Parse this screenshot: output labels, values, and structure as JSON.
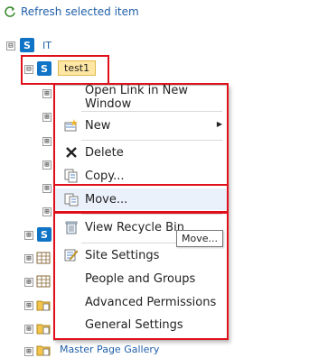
{
  "toolbar": {
    "refresh_label": "Refresh selected item"
  },
  "tree": {
    "root_label": "IT",
    "root_expander": "⊟",
    "selected_label": "test1",
    "selected_expander": "⊟",
    "collapsed_expander": "⊞",
    "bottom_item_label": "Master Page Gallery"
  },
  "context_menu": {
    "items": [
      {
        "label": "Open Link in New Window",
        "icon": "none"
      },
      {
        "label": "New",
        "icon": "new-icon",
        "submenu": "▶"
      },
      {
        "label": "Delete",
        "icon": "delete-x-icon"
      },
      {
        "label": "Copy...",
        "icon": "copy-icon"
      },
      {
        "label": "Move...",
        "icon": "move-icon"
      },
      {
        "label": "View Recycle Bin",
        "icon": "recycle-bin-icon"
      },
      {
        "label": "Site Settings",
        "icon": "site-settings-icon"
      },
      {
        "label": "People and Groups",
        "icon": "none"
      },
      {
        "label": "Advanced Permissions",
        "icon": "none"
      },
      {
        "label": "General Settings",
        "icon": "none"
      }
    ]
  },
  "tooltip": {
    "text": "Move..."
  },
  "colors": {
    "highlight_red": "#e0101a",
    "link_blue": "#1f5fa8",
    "sharepoint_blue": "#0f73c6"
  }
}
